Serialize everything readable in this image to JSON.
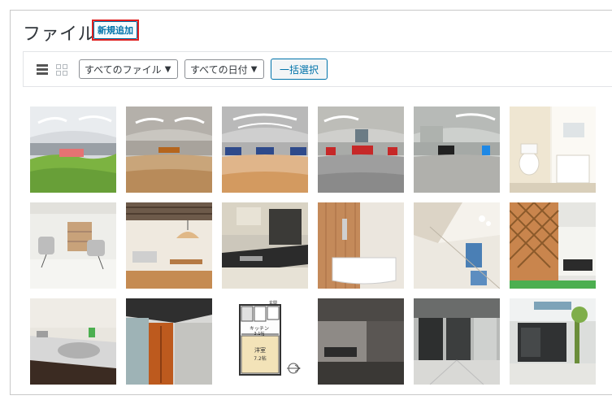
{
  "page": {
    "title": "ファイル",
    "add_new_label": "新規追加"
  },
  "toolbar": {
    "file_type_filter": "すべてのファイル",
    "date_filter": "すべての日付",
    "bulk_select_label": "一括選択"
  },
  "media": {
    "items": [
      {
        "name": "panorama-lobby-green-carpet"
      },
      {
        "name": "panorama-hall-wood-floor"
      },
      {
        "name": "panorama-hall-blue-sofas"
      },
      {
        "name": "panorama-lounge-red-chairs"
      },
      {
        "name": "panorama-room-black-chair"
      },
      {
        "name": "toilet-room"
      },
      {
        "name": "living-room-chairs"
      },
      {
        "name": "dining-room-pendant-lamp"
      },
      {
        "name": "kitchen-counter"
      },
      {
        "name": "bathroom-tub"
      },
      {
        "name": "atrium-ceiling"
      },
      {
        "name": "wooden-lattice-fence"
      },
      {
        "name": "kitchen-sink"
      },
      {
        "name": "entrance-wood-door"
      },
      {
        "name": "floor-plan"
      },
      {
        "name": "office-meeting-room"
      },
      {
        "name": "building-entrance-hall"
      },
      {
        "name": "building-exterior"
      }
    ],
    "floor_plan": {
      "room1": "キッチン",
      "room1_size": "3.1帖",
      "room2": "洋室",
      "room2_size": "7.2帖",
      "label": "玄関"
    }
  }
}
